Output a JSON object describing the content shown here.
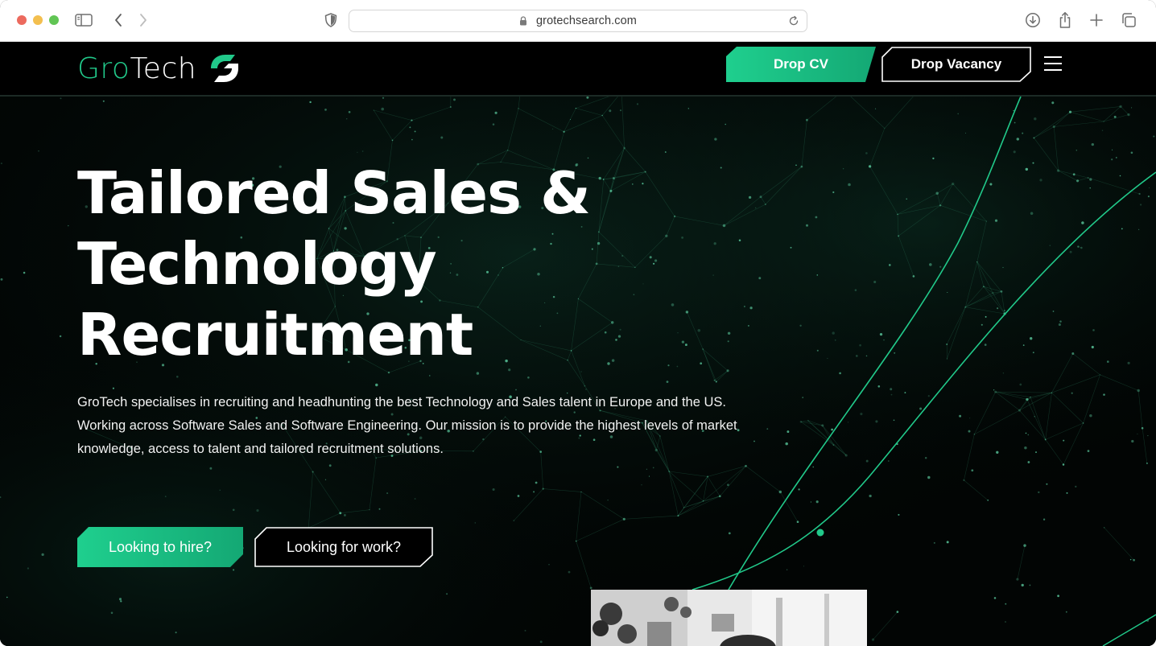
{
  "browser": {
    "url": "grotechsearch.com",
    "icons": [
      "sidebar-icon",
      "back-icon",
      "forward-icon",
      "privacy-shield-icon",
      "lock-icon",
      "reload-icon",
      "download-icon",
      "share-icon",
      "new-tab-icon",
      "tabs-overview-icon"
    ]
  },
  "header": {
    "logo_primary": "Gro",
    "logo_secondary": "Tech",
    "drop_cv_label": "Drop CV",
    "drop_vacancy_label": "Drop Vacancy",
    "menu_icon": "hamburger-menu-icon"
  },
  "hero": {
    "title_lines": [
      "Tailored Sales &",
      "Technology",
      "Recruitment"
    ],
    "description_lines": [
      "GroTech specialises in recruiting and headhunting the best Technology and Sales talent in Europe and the US.",
      "Working across Software Sales and Software Engineering. Our mission is to provide the highest levels of market",
      "knowledge, access to talent and tailored recruitment solutions."
    ],
    "hire_label": "Looking to hire?",
    "work_label": "Looking for work?"
  },
  "colors": {
    "accent_green": "#21c98a",
    "background": "#020504",
    "text": "#ffffff"
  }
}
